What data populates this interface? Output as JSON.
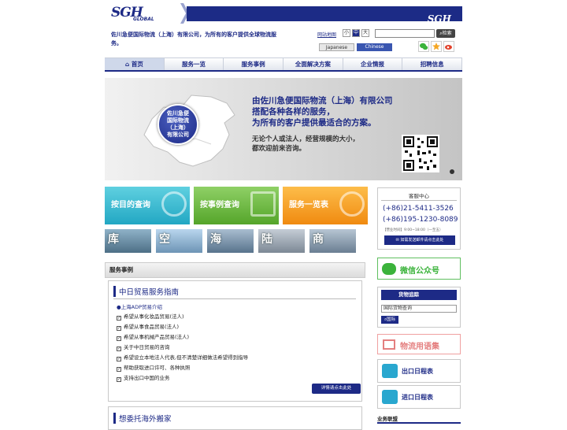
{
  "header": {
    "logo_text": "SGH",
    "logo_sub": "GLOBAL",
    "logo_right": "SGH",
    "tagline": "佐川急便国际物流（上海）有限公司，为所有的客户提供全球物流服务。",
    "site_map": "网站地图",
    "font_sizes": [
      "小",
      "中",
      "大"
    ],
    "search_button": "检索",
    "lang_japanese": "Japanese",
    "lang_chinese": "Chinese"
  },
  "nav": {
    "items": [
      "首页",
      "服务一览",
      "服务事例",
      "全面解决方案",
      "企业情报",
      "招聘信息"
    ]
  },
  "banner": {
    "circle_lines": [
      "佐川急便",
      "国际物流",
      "（上海）",
      "有限公司"
    ],
    "headline": [
      "由佐川急便国际物流（上海）有限公司",
      "搭配各种各样的服务，",
      "为所有的客户提供最适合的方案。"
    ],
    "subline": [
      "无论个人或法人，经营规模的大小，",
      "都欢迎前来咨询。"
    ]
  },
  "tiles": {
    "destination": "按目的查询",
    "cases": "按事例查询",
    "services": "服务一览表"
  },
  "photos": [
    "库",
    "空",
    "海",
    "陆",
    "商"
  ],
  "service_cases": {
    "section_title": "服务事例",
    "box_title": "中日贸易服务指南",
    "sub_link": "●上海ADP贸易介绍",
    "items": [
      "希望从事化妆品贸易(法人)",
      "希望从事食品贸易(法人)",
      "希望从事机械产品贸易(法人)",
      "关于中日贸易的咨询",
      "希望设立本地法人代表,但不清楚详细做法希望得到指导",
      "帮助获取进口许可、各种执照",
      "支持出口中国的业务"
    ],
    "details_button": "详情请点击此处",
    "box2_title": "想委托海外搬家"
  },
  "sidebar": {
    "customer_center": "客服中心",
    "phone1": "(+86)21-5411-3526",
    "phone2": "(+86)195-1230-8089",
    "hours": "【营业时间】9:00~18:00（一至五）",
    "mail_button": "如需发送邮件请点击此处",
    "wechat": "微信公众号",
    "tracking_title": "货物追踪",
    "tracking_input": "国际货物查询",
    "tracking_button": "国际",
    "glossary": "物流用语集",
    "export_schedule": "出口日程表",
    "import_schedule": "进口日程表",
    "alliance": "业务联盟"
  },
  "colors": {
    "brand_navy": "#1d2a86",
    "wechat_green": "#3bb33b",
    "glossary_pink": "#e47f7f",
    "tile_cyan": "#22a7c3",
    "tile_green": "#55a52a",
    "tile_orange": "#f08a10"
  }
}
